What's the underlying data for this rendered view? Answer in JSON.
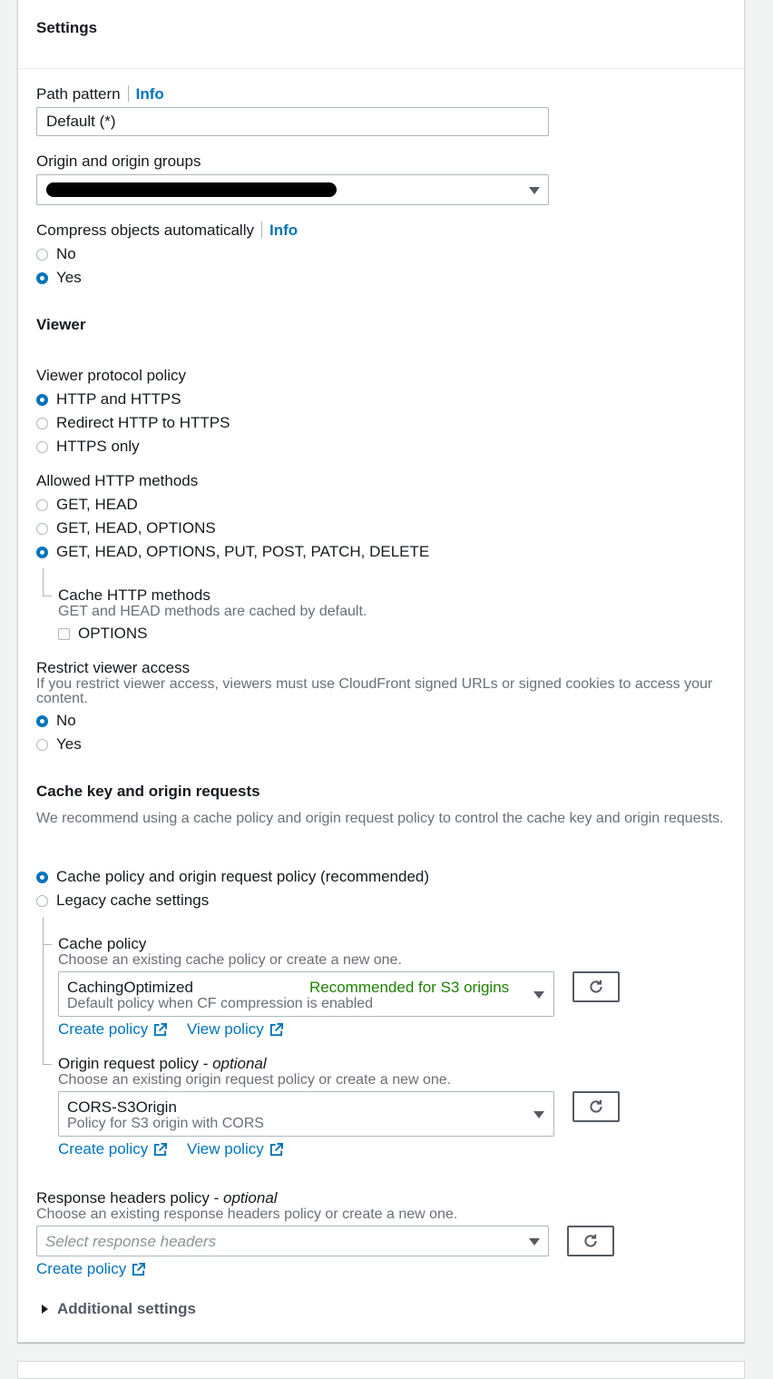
{
  "settings": {
    "title": "Settings",
    "path_pattern": {
      "label": "Path pattern",
      "info": "Info",
      "value": "Default (*)"
    },
    "origin": {
      "label": "Origin and origin groups",
      "value_redacted": true
    },
    "compress": {
      "label": "Compress objects automatically",
      "info": "Info",
      "options": [
        {
          "label": "No",
          "selected": false
        },
        {
          "label": "Yes",
          "selected": true
        }
      ]
    }
  },
  "viewer": {
    "title": "Viewer",
    "protocol_policy": {
      "label": "Viewer protocol policy",
      "options": [
        {
          "label": "HTTP and HTTPS",
          "selected": true
        },
        {
          "label": "Redirect HTTP to HTTPS",
          "selected": false
        },
        {
          "label": "HTTPS only",
          "selected": false
        }
      ]
    },
    "allowed_methods": {
      "label": "Allowed HTTP methods",
      "options": [
        {
          "label": "GET, HEAD",
          "selected": false
        },
        {
          "label": "GET, HEAD, OPTIONS",
          "selected": false
        },
        {
          "label": "GET, HEAD, OPTIONS, PUT, POST, PATCH, DELETE",
          "selected": true
        }
      ]
    },
    "cache_methods": {
      "label": "Cache HTTP methods",
      "description": "GET and HEAD methods are cached by default.",
      "checkbox_label": "OPTIONS",
      "checked": false
    },
    "restrict_access": {
      "label": "Restrict viewer access",
      "description": "If you restrict viewer access, viewers must use CloudFront signed URLs or signed cookies to access your content.",
      "options": [
        {
          "label": "No",
          "selected": true
        },
        {
          "label": "Yes",
          "selected": false
        }
      ]
    }
  },
  "cache_key": {
    "title": "Cache key and origin requests",
    "description": "We recommend using a cache policy and origin request policy to control the cache key and origin requests.",
    "options": [
      {
        "label": "Cache policy and origin request policy (recommended)",
        "selected": true
      },
      {
        "label": "Legacy cache settings",
        "selected": false
      }
    ],
    "cache_policy": {
      "label": "Cache policy",
      "description": "Choose an existing cache policy or create a new one.",
      "selected_name": "CachingOptimized",
      "selected_badge": "Recommended for S3 origins",
      "selected_description": "Default policy when CF compression is enabled",
      "create_link": "Create policy",
      "view_link": "View policy"
    },
    "origin_request_policy": {
      "label": "Origin request policy",
      "optional": "optional",
      "description": "Choose an existing origin request policy or create a new one.",
      "selected_name": "CORS-S3Origin",
      "selected_description": "Policy for S3 origin with CORS",
      "create_link": "Create policy",
      "view_link": "View policy"
    }
  },
  "response_headers": {
    "label": "Response headers policy",
    "optional": "optional",
    "description": "Choose an existing response headers policy or create a new one.",
    "placeholder": "Select response headers",
    "create_link": "Create policy"
  },
  "additional_settings": {
    "label": "Additional settings"
  },
  "dash": " - "
}
